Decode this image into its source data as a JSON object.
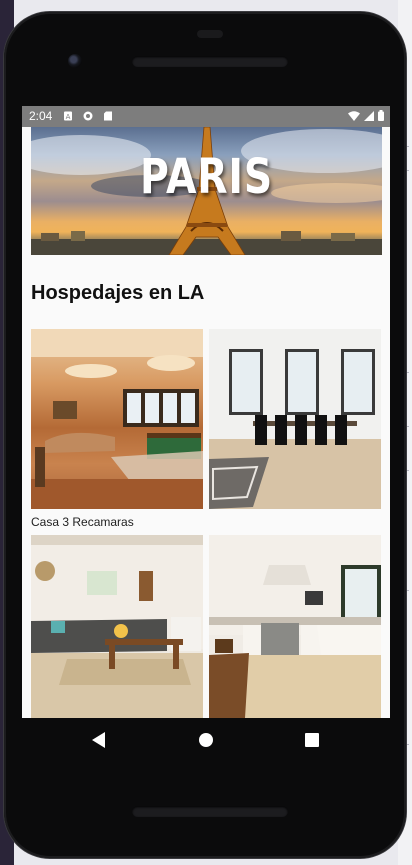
{
  "status_bar": {
    "time": "2:04",
    "icons": [
      "sim-card-icon",
      "app-notification-icon",
      "sd-card-icon"
    ],
    "right_icons": [
      "wifi-icon",
      "cell-signal-icon",
      "battery-icon"
    ]
  },
  "hero": {
    "title": "PARIS",
    "image": "eiffel-tower-sunset-photo"
  },
  "section": {
    "title": "Hospedajes en LA"
  },
  "listings": [
    {
      "image": "living-room-pool-table-photo",
      "caption": "Casa 3 Recamaras"
    },
    {
      "image": "white-loft-dining-photo",
      "caption": ""
    },
    {
      "image": "cozy-living-room-photo",
      "caption": ""
    },
    {
      "image": "white-kitchen-photo",
      "caption": ""
    }
  ],
  "nav": {
    "back": "back-icon",
    "home": "home-icon",
    "recents": "recents-icon"
  },
  "colors": {
    "status_bar": "#7d7d7d",
    "screen_bg": "#fafafa",
    "phone_body": "#0b0b0c"
  }
}
